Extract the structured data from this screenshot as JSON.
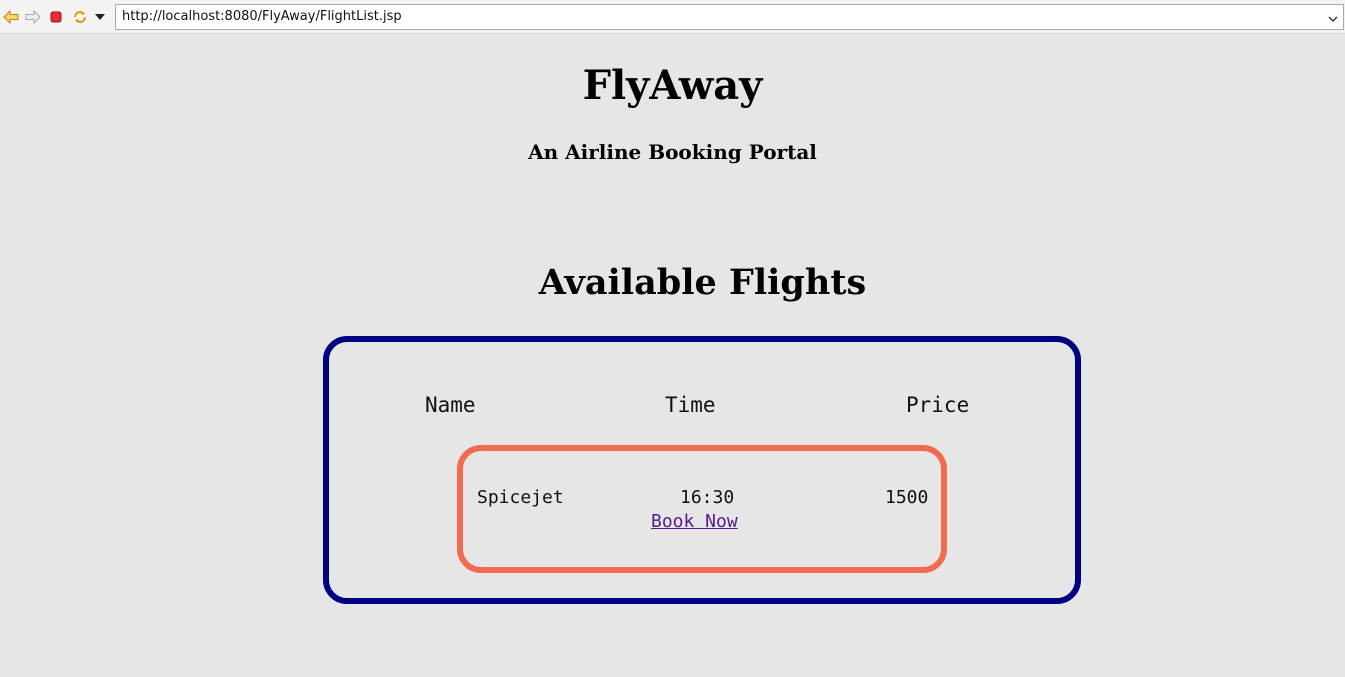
{
  "browser": {
    "url": "http://localhost:8080/FlyAway/FlightList.jsp",
    "icons": [
      "back-icon",
      "forward-icon",
      "stop-icon",
      "refresh-icon",
      "menu-dropdown-icon",
      "url-dropdown-icon"
    ]
  },
  "page": {
    "title": "FlyAway",
    "subtitle": "An Airline Booking Portal",
    "section_title": "Available Flights"
  },
  "table": {
    "headers": [
      "Name",
      "Time",
      "Price"
    ],
    "rows": [
      {
        "name": "Spicejet",
        "time": "16:30",
        "price": "1500",
        "action": "Book Now"
      }
    ]
  },
  "colors": {
    "background": "#e6e6e6",
    "outer_border": "#000080",
    "card_border": "#f26a4f",
    "link": "#551a8b"
  }
}
